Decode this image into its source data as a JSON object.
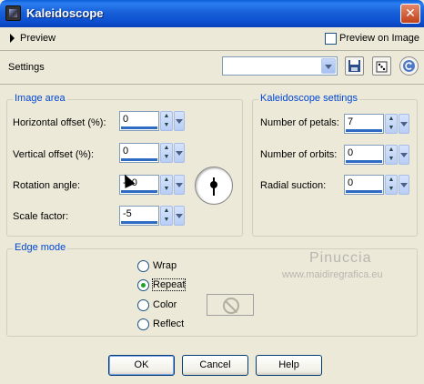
{
  "window": {
    "title": "Kaleidoscope",
    "close_glyph": "✕"
  },
  "preview": {
    "label": "Preview",
    "preview_on_image_label": "Preview on Image",
    "preview_on_image_checked": false
  },
  "settings": {
    "label": "Settings",
    "preset_value": ""
  },
  "image_area": {
    "title": "Image area",
    "horizontal_offset": {
      "label": "Horizontal offset (%):",
      "value": "0"
    },
    "vertical_offset": {
      "label": "Vertical offset (%):",
      "value": "0"
    },
    "rotation_angle": {
      "label": "Rotation angle:",
      "value": "-90"
    },
    "scale_factor": {
      "label": "Scale factor:",
      "value": "-5"
    }
  },
  "kaleidoscope_settings": {
    "title": "Kaleidoscope settings",
    "number_of_petals": {
      "label": "Number of petals:",
      "value": "7"
    },
    "number_of_orbits": {
      "label": "Number of orbits:",
      "value": "0"
    },
    "radial_suction": {
      "label": "Radial suction:",
      "value": "0"
    }
  },
  "edge_mode": {
    "title": "Edge mode",
    "options": [
      {
        "label": "Wrap",
        "selected": false
      },
      {
        "label": "Repeat",
        "selected": true
      },
      {
        "label": "Color",
        "selected": false
      },
      {
        "label": "Reflect",
        "selected": false
      }
    ]
  },
  "watermark": {
    "line1": "Pinuccia",
    "line2": "www.maidiregrafica.eu"
  },
  "buttons": {
    "ok": "OK",
    "cancel": "Cancel",
    "help": "Help"
  },
  "spin_arrows": {
    "up": "▲",
    "down": "▼"
  },
  "colors": {
    "title_bar": "#0b4fd0",
    "dialog_bg": "#ece9d8",
    "group_title": "#0046d5"
  }
}
